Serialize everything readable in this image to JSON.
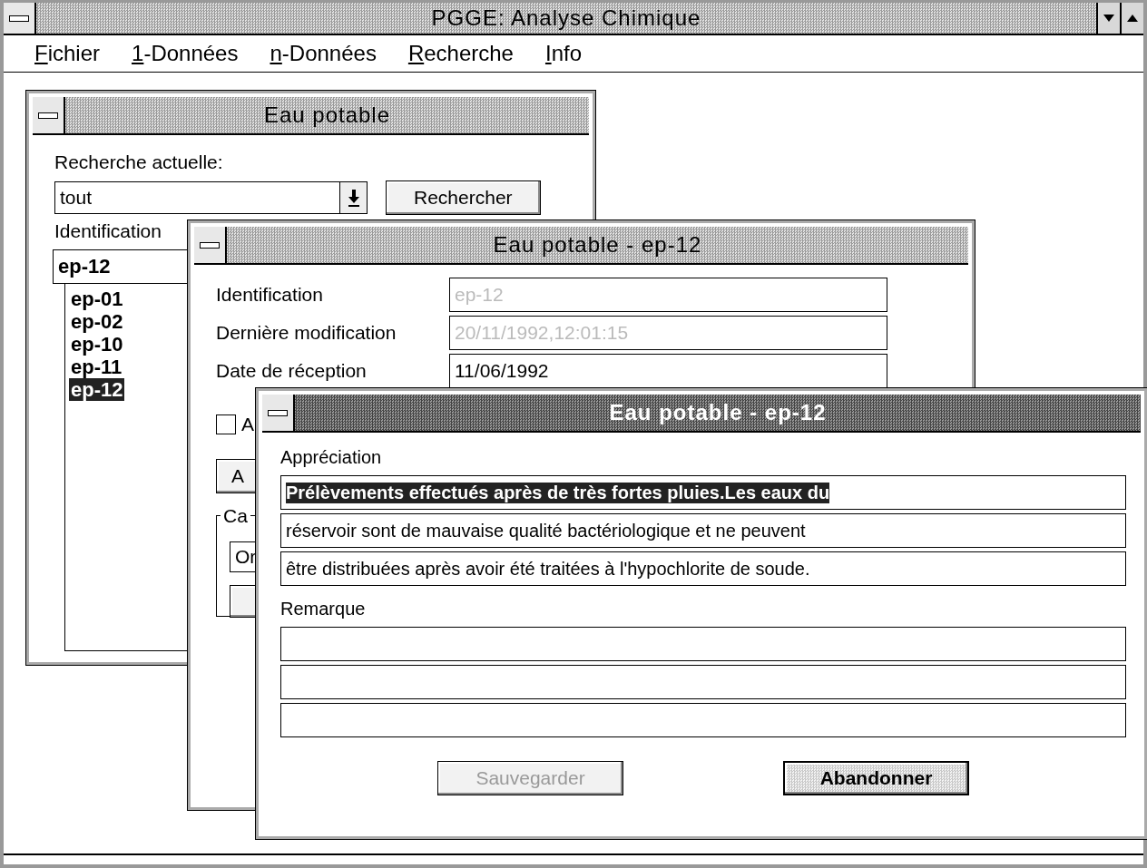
{
  "window": {
    "title": "PGGE: Analyse Chimique"
  },
  "menu": [
    {
      "label": "Fichier"
    },
    {
      "label": "1-Données"
    },
    {
      "label": "n-Données"
    },
    {
      "label": "Recherche"
    },
    {
      "label": "Info"
    }
  ],
  "search_window": {
    "title": "Eau potable",
    "active": false,
    "search_label": "Recherche actuelle:",
    "search_value": "tout",
    "search_button": "Rechercher",
    "id_label": "Identification",
    "id_value": "ep-12",
    "items": [
      {
        "label": "ep-01",
        "selected": false
      },
      {
        "label": "ep-02",
        "selected": false
      },
      {
        "label": "ep-10",
        "selected": false
      },
      {
        "label": "ep-11",
        "selected": false
      },
      {
        "label": "ep-12",
        "selected": true
      }
    ]
  },
  "detail_window": {
    "title": "Eau potable - ep-12",
    "active": false,
    "fields": [
      {
        "label": "Identification",
        "value": "ep-12",
        "disabled": true
      },
      {
        "label": "Dernière modification",
        "value": "20/11/1992,12:01:15",
        "disabled": true
      },
      {
        "label": "Date de réception",
        "value": "11/06/1992",
        "disabled": false
      }
    ],
    "checkbox": {
      "label": "A",
      "checked": false
    },
    "button": "A",
    "group": {
      "label": "Ca",
      "field_value": "Or"
    }
  },
  "comment_window": {
    "title": "Eau potable - ep-12",
    "active": true,
    "appreciation": {
      "label": "Appréciation",
      "lines": [
        {
          "text": "Prélèvements effectués après de très fortes pluies.Les eaux du",
          "selected": true
        },
        {
          "text": "réservoir sont de mauvaise qualité bactériologique et ne peuvent",
          "selected": false
        },
        {
          "text": "être distribuées après avoir été traitées à l'hypochlorite de soude.",
          "selected": false
        }
      ]
    },
    "remark": {
      "label": "Remarque",
      "lines": [
        {
          "selected": false
        },
        {
          "selected": false
        },
        {
          "selected": false
        }
      ]
    },
    "buttons": [
      {
        "label": "Sauvegarder",
        "disabled": true,
        "focused": false
      },
      {
        "label": "Abandonner",
        "disabled": false,
        "focused": true
      }
    ]
  }
}
